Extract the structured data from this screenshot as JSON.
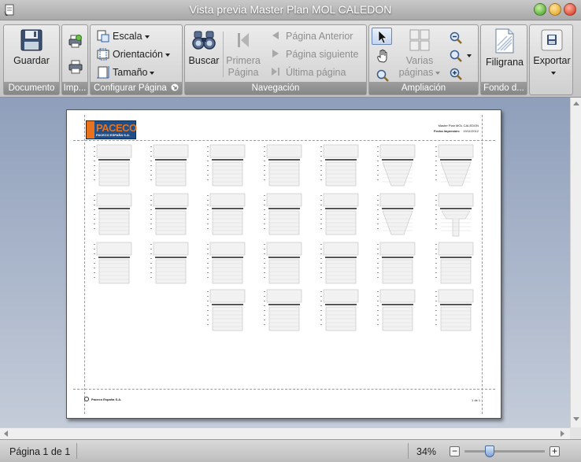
{
  "window": {
    "title": "Vista previa Master Plan MOL CALEDON"
  },
  "ribbon": {
    "documento": {
      "label": "Documento",
      "save": "Guardar"
    },
    "imprimir": {
      "label": "Imp..."
    },
    "configurar": {
      "label": "Configurar Página",
      "escala": "Escala",
      "orientacion": "Orientación",
      "tamano": "Tamaño"
    },
    "navegacion": {
      "label": "Navegación",
      "buscar": "Buscar",
      "primera_line1": "Primera",
      "primera_line2": "Página",
      "anterior": "Página Anterior",
      "siguiente": "Página siguiente",
      "ultima": "Última página"
    },
    "ampliacion": {
      "label": "Ampliación",
      "varias_line1": "Varias",
      "varias_line2": "páginas"
    },
    "fondo": {
      "label": "Fondo d...",
      "filigrana": "Filigrana"
    },
    "exportar": {
      "label": "Exportar"
    }
  },
  "document_page": {
    "logo_name": "PACECO",
    "logo_sub": "PACECO ESPAÑA S.A.",
    "header_title": "Master Plan MOL CALEDON",
    "header_date_label": "Fecha impresión:",
    "header_date_value": "19/11/2012",
    "footer_company": "Paceco España S.A.",
    "footer_page": "1 de 1"
  },
  "status": {
    "page_info": "Página 1 de 1",
    "zoom": "34%",
    "zoom_level": 34
  },
  "colors": {
    "logo_orange": "#e8731c",
    "logo_blue": "#1f4f8a",
    "link_blue": "#2a5fb0"
  },
  "icons": {
    "save": "floppy-disk-icon",
    "print_setup": "printer-settings-icon",
    "print": "printer-icon",
    "search": "binoculars-icon",
    "watermark": "watermark-page-icon",
    "export": "export-disk-icon"
  }
}
